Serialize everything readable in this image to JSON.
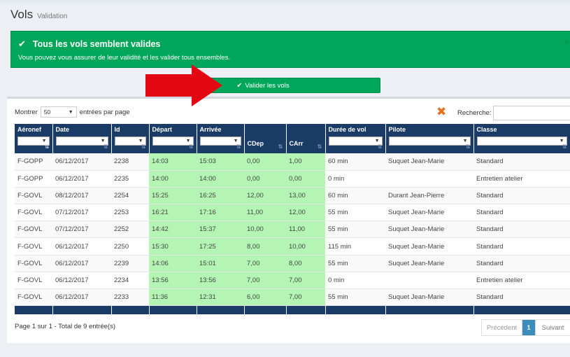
{
  "header": {
    "title": "Vols",
    "subtitle": "Validation"
  },
  "alert": {
    "title": "Tous les vols semblent valides",
    "message": "Vous pouvez vous assurer de leur validité et les valider tous ensembles.",
    "close": "×"
  },
  "actions": {
    "validate_label": "Valider les vols"
  },
  "length": {
    "prefix": "Montrer",
    "value": "50",
    "suffix": "entrées par page"
  },
  "search": {
    "label": "Recherche:",
    "value": ""
  },
  "table": {
    "columns": [
      "Aéronef",
      "Date",
      "Id",
      "Départ",
      "Arrivée",
      "CDep",
      "CArr",
      "Durée de vol",
      "Pilote",
      "Classe"
    ],
    "rows": [
      [
        "F-GOPP",
        "06/12/2017",
        "2238",
        "14:03",
        "15:03",
        "0,00",
        "1,00",
        "60 min",
        "Suquet Jean-Marie",
        "Standard"
      ],
      [
        "F-GOPP",
        "06/12/2017",
        "2235",
        "14:00",
        "14:00",
        "0,00",
        "0,00",
        "0 min",
        "",
        "Entretien atelier"
      ],
      [
        "F-GOVL",
        "08/12/2017",
        "2254",
        "15:25",
        "16:25",
        "12,00",
        "13,00",
        "60 min",
        "Durant Jean-Pierre",
        "Standard"
      ],
      [
        "F-GOVL",
        "07/12/2017",
        "2253",
        "16:21",
        "17:16",
        "11,00",
        "12,00",
        "55 min",
        "Suquet Jean-Marie",
        "Standard"
      ],
      [
        "F-GOVL",
        "07/12/2017",
        "2252",
        "14:42",
        "15:37",
        "10,00",
        "11,00",
        "55 min",
        "Suquet Jean-Marie",
        "Standard"
      ],
      [
        "F-GOVL",
        "06/12/2017",
        "2250",
        "15:30",
        "17:25",
        "8,00",
        "10,00",
        "115 min",
        "Suquet Jean-Marie",
        "Standard"
      ],
      [
        "F-GOVL",
        "06/12/2017",
        "2239",
        "14:06",
        "15:01",
        "7,00",
        "8,00",
        "55 min",
        "Suquet Jean-Marie",
        "Standard"
      ],
      [
        "F-GOVL",
        "06/12/2017",
        "2234",
        "13:56",
        "13:56",
        "7,00",
        "7,00",
        "0 min",
        "",
        "Entretien atelier"
      ],
      [
        "F-GOVL",
        "06/12/2017",
        "2233",
        "11:36",
        "12:31",
        "6,00",
        "7,00",
        "55 min",
        "Suquet Jean-Marie",
        "Standard"
      ]
    ]
  },
  "footer": {
    "info": "Page 1 sur 1 - Total de 9 entrée(s)"
  },
  "pagination": {
    "prev": "Précédent",
    "current": "1",
    "next": "Suivant"
  },
  "colors": {
    "success": "#00a65a",
    "table_header": "#1b3b67",
    "highlight_cell": "#b4f5b4",
    "arrow": "#e30613",
    "pager_active": "#3c8dbc"
  }
}
